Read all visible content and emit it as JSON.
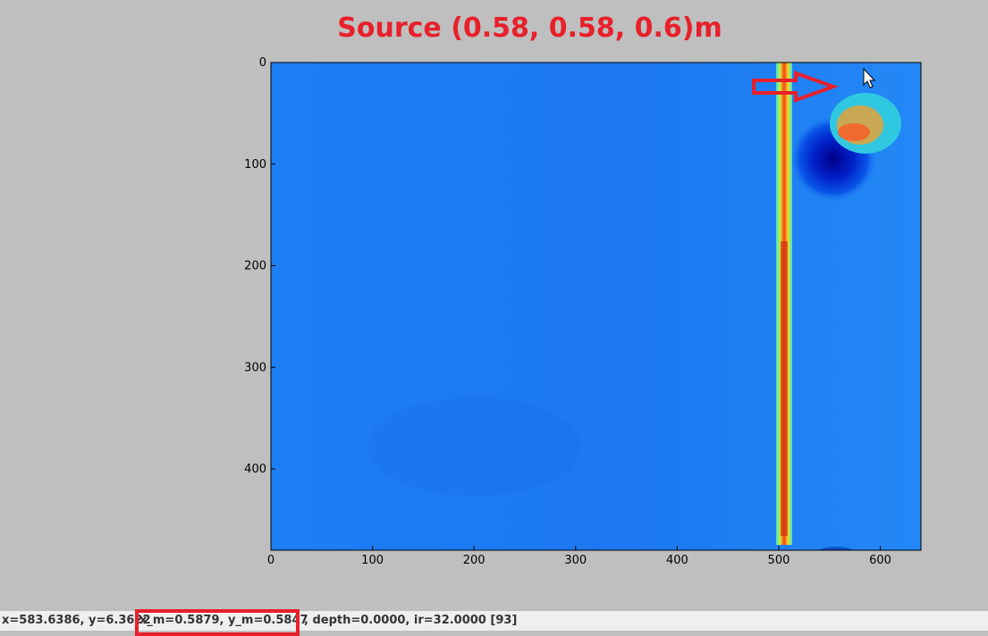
{
  "title": "Source (0.58, 0.58, 0.6)m",
  "image_plot": {
    "x_ticks": [
      "0",
      "100",
      "200",
      "300",
      "400",
      "500",
      "600"
    ],
    "y_ticks": [
      "0",
      "100",
      "200",
      "300",
      "400"
    ],
    "x_range": [
      0,
      640
    ],
    "y_range": [
      0,
      480
    ],
    "colormap": "jet",
    "background_color": "#1f7ff5",
    "arrow_color": "#e8202a"
  },
  "statusbar": {
    "coords": "x=583.6386, y=6.3622",
    "metric": "x_m=0.5879, y_m=0.5847",
    "extra": ", depth=0.0000, ir=32.0000 [93]"
  }
}
